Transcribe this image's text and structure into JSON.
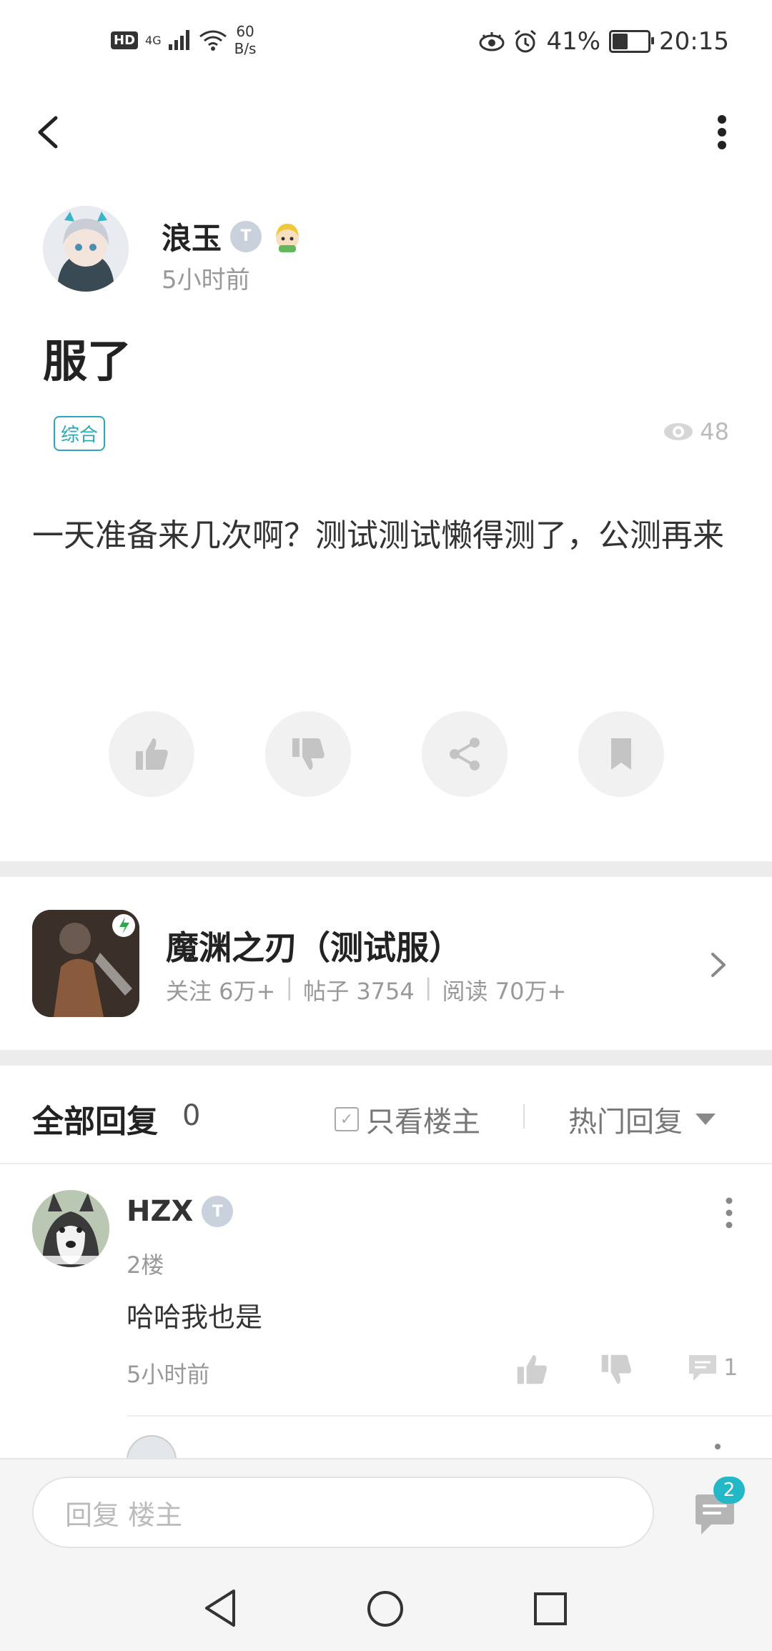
{
  "status_bar": {
    "hd": "HD",
    "network": "4G",
    "speed_value": "60",
    "speed_unit": "B/s",
    "battery": "41%",
    "time": "20:15"
  },
  "post": {
    "author": "浪玉",
    "author_level": "T",
    "time": "5小时前",
    "title": "服了",
    "tag": "综合",
    "views": "48",
    "content": "一天准备来几次啊？测试测试懒得测了，公测再来"
  },
  "game": {
    "name": "魔渊之刃（测试服）",
    "stats": [
      "关注 6万+",
      "|",
      "帖子 3754",
      "|",
      "阅读 70万+"
    ]
  },
  "replies_header": {
    "title": "全部回复",
    "count": "0",
    "only_owner": "只看楼主",
    "sort": "热门回复"
  },
  "replies": [
    {
      "name": "HZX",
      "level": "T",
      "floor": "2楼",
      "text": "哈哈我也是",
      "time": "5小时前",
      "comment_count": "1"
    }
  ],
  "reply_bar": {
    "placeholder": "回复  楼主",
    "badge": "2"
  },
  "colors": {
    "accent": "#2aa8b8",
    "badge": "#22b8c8"
  }
}
